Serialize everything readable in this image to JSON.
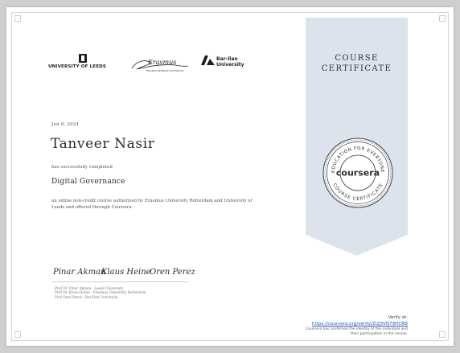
{
  "logos": {
    "leeds": "UNIVERSITY OF LEEDS",
    "erasmus_script": "Erasmus",
    "erasmus_sub": "ERASMUS UNIVERSITY ROTTERDAM",
    "barilan_line1": "Bar-Ilan",
    "barilan_line2": "University"
  },
  "ribbon": {
    "title_line1": "COURSE",
    "title_line2": "CERTIFICATE",
    "color": "#dde3ec"
  },
  "seal": {
    "top_arc_text": "EDUCATION FOR EVERYONE",
    "bottom_arc_text": "COURSE CERTIFICATE",
    "brand": "coursera"
  },
  "certificate": {
    "date": "Jun 6, 2024",
    "recipient": "Tanveer Nasir",
    "completed_text": "has successfully completed",
    "course_name": "Digital Governance",
    "description": "an online non-credit course authorized by Erasmus University Rotterdam and University of Leeds and offered through Coursera"
  },
  "signatures": {
    "sig1": "Pinar Akman",
    "sig2": "Klaus Heine",
    "sig3": "Oren Perez"
  },
  "signers": [
    "Prof Dr. Pinar Akman - Leeds University",
    "Prof Dr. Klaus Heine - Erasmus University Rotterdam",
    "Prof Oren Perez - Bar-Ilan University"
  ],
  "verification": {
    "label": "Verify at:",
    "url": "https://coursera.org/verify/ZUJ3VN79HCRB",
    "note_line1": "Coursera has confirmed the identity of this individual and",
    "note_line2": "their participation in the course."
  }
}
